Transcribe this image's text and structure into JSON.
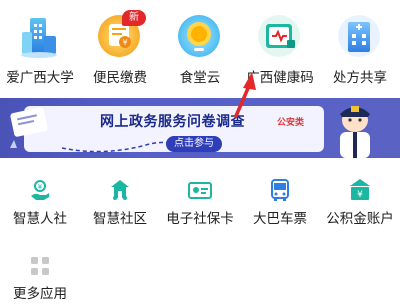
{
  "top_apps": [
    {
      "label": "爱广西大学",
      "icon": "university-building-icon"
    },
    {
      "label": "便民缴费",
      "icon": "payment-icon",
      "badge": "新"
    },
    {
      "label": "食堂云",
      "icon": "canteen-cloud-icon"
    },
    {
      "label": "广西健康码",
      "icon": "health-code-icon"
    },
    {
      "label": "处方共享",
      "icon": "prescription-building-icon"
    }
  ],
  "banner": {
    "title": "网上政务服务问卷调查",
    "tag": "公安类",
    "button": "点击参与"
  },
  "services": [
    {
      "label": "智慧人社",
      "icon": "hand-coin-icon"
    },
    {
      "label": "智慧社区",
      "icon": "community-icon"
    },
    {
      "label": "电子社保卡",
      "icon": "id-card-icon"
    },
    {
      "label": "大巴车票",
      "icon": "bus-icon"
    },
    {
      "label": "公积金账户",
      "icon": "fund-account-icon"
    }
  ],
  "more": {
    "label": "更多应用",
    "icon": "grid-icon"
  },
  "colors": {
    "accent_teal": "#1bb7a1",
    "banner_blue": "#4a53b6",
    "badge_red": "#e3282b",
    "annotation_red": "#e3282b"
  }
}
